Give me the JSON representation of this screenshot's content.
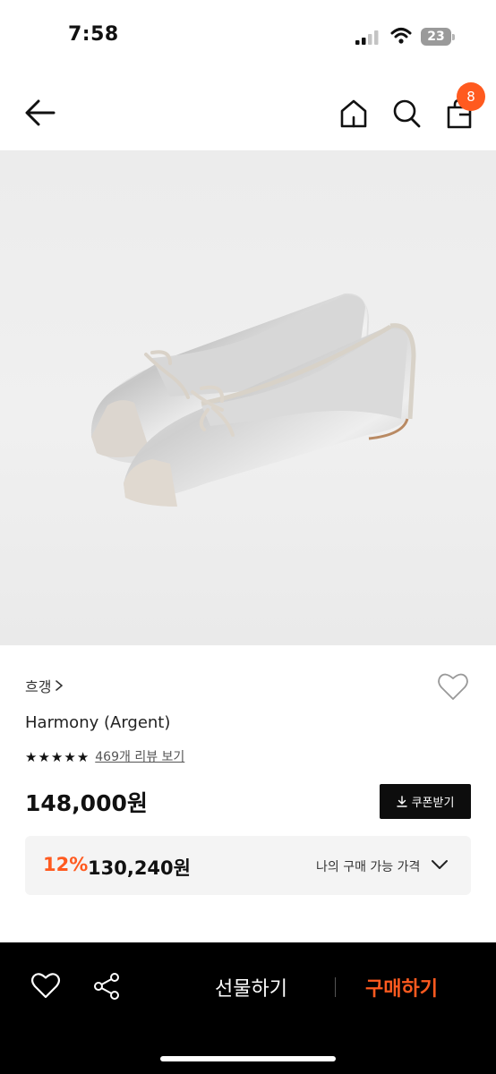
{
  "status_bar": {
    "time": "7:58",
    "battery_level": "23",
    "icons": [
      "cellular-signal-icon",
      "wifi-icon",
      "battery-icon"
    ]
  },
  "nav": {
    "icons": [
      "back-arrow-icon",
      "home-icon",
      "search-icon",
      "shopping-bag-icon"
    ],
    "cart_count": "8",
    "badge_color": "#ff5a1f"
  },
  "product": {
    "brand": "흐갱",
    "title": "Harmony (Argent)",
    "rating_stars": 5,
    "review_link": "469개 리뷰 보기",
    "price": "148,000원",
    "coupon_label": "쿠폰받기",
    "image_description_icon": "silver-ballet-flats-image"
  },
  "discount": {
    "rate": "12%",
    "price": "130,240원",
    "label": "나의 구매 가능 가격",
    "accent_color": "#ff5a1f"
  },
  "bottom_bar": {
    "gift_label": "선물하기",
    "buy_label": "구매하기",
    "icons": [
      "heart-outline-icon",
      "share-icon"
    ]
  }
}
